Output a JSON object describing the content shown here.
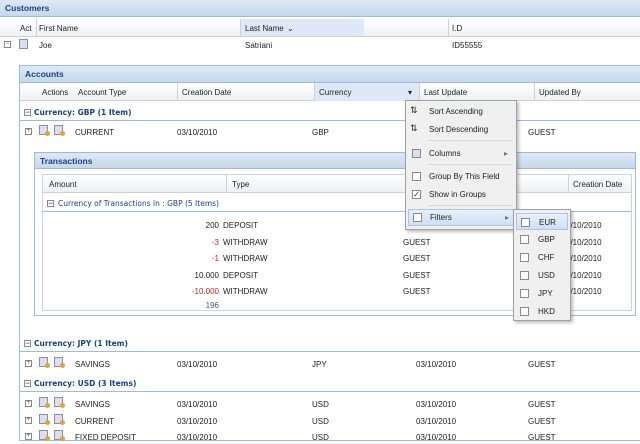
{
  "customers": {
    "title": "Customers",
    "columns": [
      "Act",
      "First Name",
      "Last Name",
      "I.D"
    ],
    "sort_arrow": "⌄",
    "row": {
      "first_name": "Joe",
      "last_name": "Satriani",
      "id": "ID55555"
    }
  },
  "accounts": {
    "title": "Accounts",
    "columns": [
      "Actions",
      "Account Type",
      "Creation Date",
      "Currency",
      "Last Update",
      "Updated By"
    ],
    "currency_dropdown": "▾",
    "groups": [
      {
        "label": "Currency: GBP (1 Item)",
        "rows": [
          {
            "type": "CURRENT",
            "created": "03/10/2010",
            "currency": "GBP",
            "updated": "",
            "by": "GUEST"
          }
        ]
      },
      {
        "label": "Currency: JPY (1 Item)",
        "rows": [
          {
            "type": "SAVINGS",
            "created": "03/10/2010",
            "currency": "JPY",
            "updated": "03/10/2010",
            "by": "GUEST"
          }
        ]
      },
      {
        "label": "Currency: USD (3 Items)",
        "rows": [
          {
            "type": "SAVINGS",
            "created": "03/10/2010",
            "currency": "USD",
            "updated": "03/10/2010",
            "by": "GUEST"
          },
          {
            "type": "CURRENT",
            "created": "03/10/2010",
            "currency": "USD",
            "updated": "03/10/2010",
            "by": "GUEST"
          },
          {
            "type": "FIXED DEPOSIT",
            "created": "03/10/2010",
            "currency": "USD",
            "updated": "03/10/2010",
            "by": "GUEST"
          }
        ]
      }
    ]
  },
  "transactions": {
    "title": "Transactions",
    "columns": [
      "Amount",
      "Type",
      "Creation Date"
    ],
    "group": "Currency of Transactions in : GBP (5 Items)",
    "rows": [
      {
        "amount": "200",
        "type": "DEPOSIT",
        "by": "",
        "created": "3/10/2010",
        "neg": false
      },
      {
        "amount": "-3",
        "type": "WITHDRAW",
        "by": "GUEST",
        "created": "3/10/2010",
        "neg": true
      },
      {
        "amount": "-1",
        "type": "WITHDRAW",
        "by": "GUEST",
        "created": "3/10/2010",
        "neg": true
      },
      {
        "amount": "10.000",
        "type": "DEPOSIT",
        "by": "GUEST",
        "created": "3/10/2010",
        "neg": false
      },
      {
        "amount": "-10.000",
        "type": "WITHDRAW",
        "by": "GUEST",
        "created": "3/10/2010",
        "neg": true
      }
    ],
    "total": "196"
  },
  "menu": {
    "sort_asc": "Sort Ascending",
    "sort_desc": "Sort Descending",
    "columns": "Columns",
    "group_by": "Group By This Field",
    "show_groups": "Show in Groups",
    "filters": "Filters",
    "submenu_arrow": "▸",
    "check": "✓"
  },
  "filters": [
    "EUR",
    "GBP",
    "CHF",
    "USD",
    "JPY",
    "HKD"
  ]
}
